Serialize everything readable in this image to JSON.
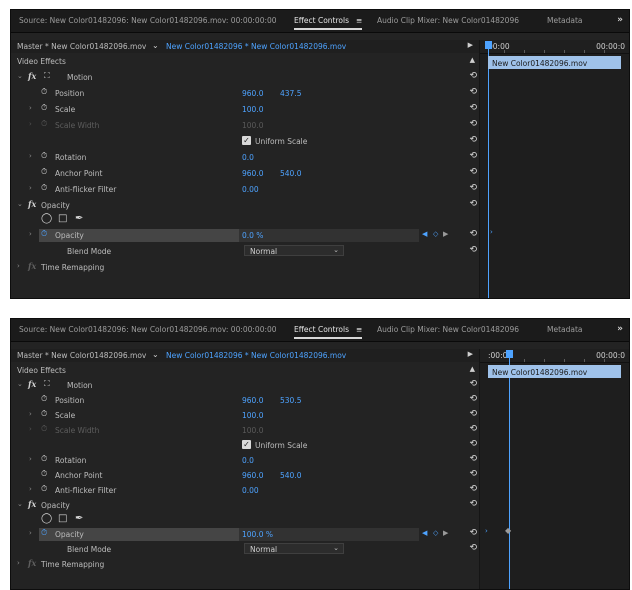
{
  "panels": [
    {
      "tabs": {
        "source": "Source: New Color01482096: New Color01482096.mov: 00:00:00:00",
        "effect_controls": "Effect Controls",
        "menu_icon": "≡",
        "audio_mixer": "Audio Clip Mixer: New Color01482096",
        "metadata": "Metadata",
        "more": "»"
      },
      "header": {
        "master": "Master * New Color01482096.mov",
        "sequence_clip": "New Color01482096 * New Color01482096.mov"
      },
      "video_effects_label": "Video Effects",
      "motion": {
        "label": "Motion",
        "position": {
          "label": "Position",
          "x": "960.0",
          "y": "437.5"
        },
        "scale": {
          "label": "Scale",
          "value": "100.0"
        },
        "scale_width": {
          "label": "Scale Width",
          "value": "100.0"
        },
        "uniform_scale": "Uniform Scale",
        "rotation": {
          "label": "Rotation",
          "value": "0.0"
        },
        "anchor_point": {
          "label": "Anchor Point",
          "x": "960.0",
          "y": "540.0"
        },
        "anti_flicker": {
          "label": "Anti-flicker Filter",
          "value": "0.00"
        }
      },
      "opacity": {
        "label": "Opacity",
        "value_label": "Opacity",
        "value": "0.0 %",
        "blend_mode_label": "Blend Mode",
        "blend_mode": "Normal"
      },
      "time_remapping": "Time Remapping",
      "timeline": {
        "start": "00:00",
        "end": "00:00:0",
        "clip": "New Color01482096.mov"
      }
    },
    {
      "tabs": {
        "source": "Source: New Color01482096: New Color01482096.mov: 00:00:00:00",
        "effect_controls": "Effect Controls",
        "menu_icon": "≡",
        "audio_mixer": "Audio Clip Mixer: New Color01482096",
        "metadata": "Metadata",
        "more": "»"
      },
      "header": {
        "master": "Master * New Color01482096.mov",
        "sequence_clip": "New Color01482096 * New Color01482096.mov"
      },
      "video_effects_label": "Video Effects",
      "motion": {
        "label": "Motion",
        "position": {
          "label": "Position",
          "x": "960.0",
          "y": "530.5"
        },
        "scale": {
          "label": "Scale",
          "value": "100.0"
        },
        "scale_width": {
          "label": "Scale Width",
          "value": "100.0"
        },
        "uniform_scale": "Uniform Scale",
        "rotation": {
          "label": "Rotation",
          "value": "0.0"
        },
        "anchor_point": {
          "label": "Anchor Point",
          "x": "960.0",
          "y": "540.0"
        },
        "anti_flicker": {
          "label": "Anti-flicker Filter",
          "value": "0.00"
        }
      },
      "opacity": {
        "label": "Opacity",
        "value_label": "Opacity",
        "value": "100.0 %",
        "blend_mode_label": "Blend Mode",
        "blend_mode": "Normal"
      },
      "time_remapping": "Time Remapping",
      "timeline": {
        "start": ":00:00",
        "end": "00:00:0",
        "clip": "New Color01482096.mov"
      }
    }
  ],
  "icons": {
    "fx": "fx",
    "stopwatch": "⏱",
    "reset": "↶",
    "twirl_open": "⌄",
    "twirl_closed": "›",
    "ellipse_mask": "◯",
    "rect_mask": "□",
    "pen_mask": "✒",
    "checkmark": "✓"
  },
  "colors": {
    "accent": "#4ea3ff",
    "panel_bg": "#232323",
    "clip_bar": "#9fc2ea"
  }
}
